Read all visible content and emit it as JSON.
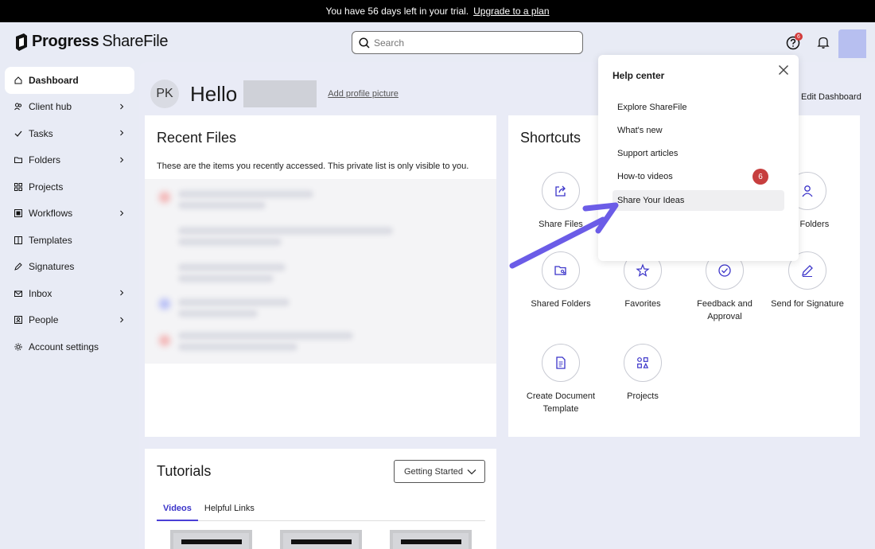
{
  "banner": {
    "text": "You have 56 days left in your trial.",
    "link": "Upgrade to a plan"
  },
  "header": {
    "logo_bold": "Progress",
    "logo_light": "ShareFile",
    "search_placeholder": "Search",
    "help_badge": "6"
  },
  "sidebar": {
    "items": [
      {
        "label": "Dashboard"
      },
      {
        "label": "Client hub"
      },
      {
        "label": "Tasks"
      },
      {
        "label": "Folders"
      },
      {
        "label": "Projects"
      },
      {
        "label": "Workflows"
      },
      {
        "label": "Templates"
      },
      {
        "label": "Signatures"
      },
      {
        "label": "Inbox"
      },
      {
        "label": "People"
      },
      {
        "label": "Account settings"
      }
    ]
  },
  "profile": {
    "initials": "PK",
    "greeting": "Hello",
    "add_picture": "Add profile picture",
    "edit_dashboard": "Edit Dashboard"
  },
  "recent_files": {
    "title": "Recent Files",
    "description": "These are the items you recently accessed. This private list is only visible to you."
  },
  "shortcuts": {
    "title": "Shortcuts",
    "items": [
      {
        "label": "Share Files",
        "icon": "share-icon"
      },
      {
        "label": "nal Folders",
        "icon": "person-icon"
      },
      {
        "label": "Shared Folders",
        "icon": "shared-folder-icon"
      },
      {
        "label": "Favorites",
        "icon": "star-icon"
      },
      {
        "label": "Feedback and Approval",
        "icon": "check-circle-icon"
      },
      {
        "label": "Send for Signature",
        "icon": "pen-icon"
      },
      {
        "label": "Create Document Template",
        "icon": "document-icon"
      },
      {
        "label": "Projects",
        "icon": "projects-icon"
      }
    ]
  },
  "tutorials": {
    "title": "Tutorials",
    "selected": "Getting Started",
    "tabs": [
      {
        "label": "Videos"
      },
      {
        "label": "Helpful Links"
      }
    ]
  },
  "help_center": {
    "title": "Help center",
    "items": [
      {
        "label": "Explore ShareFile"
      },
      {
        "label": "What's new"
      },
      {
        "label": "Support articles"
      },
      {
        "label": "How-to videos",
        "badge": "6"
      },
      {
        "label": "Share Your Ideas"
      }
    ]
  },
  "colors": {
    "accent": "#4a3fd6",
    "annotation_arrow": "#6b5ce7",
    "badge": "#c73e3e"
  }
}
